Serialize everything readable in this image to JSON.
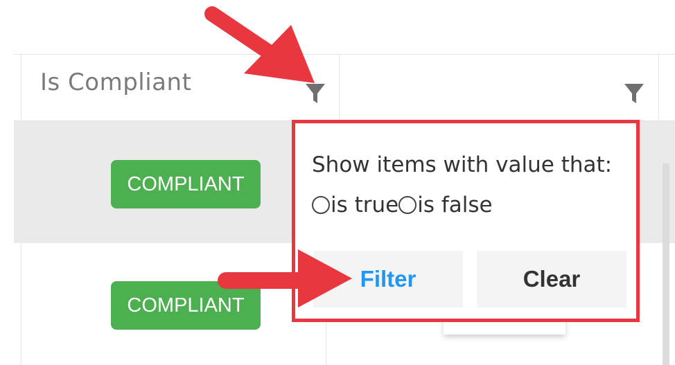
{
  "grid": {
    "columns": [
      {
        "title": "Is Compliant",
        "filter_icon": "filter-icon"
      },
      {
        "title": "",
        "filter_icon": "filter-icon"
      }
    ],
    "rows": [
      {
        "status": "COMPLIANT",
        "status_color": "#4caf50"
      },
      {
        "status": "COMPLIANT",
        "status_color": "#4caf50"
      }
    ]
  },
  "filter_popup": {
    "title": "Show items with value that:",
    "options": [
      {
        "label": "is true",
        "selected": false
      },
      {
        "label": "is false",
        "selected": false
      }
    ],
    "filter_label": "Filter",
    "clear_label": "Clear",
    "highlight_color": "#e8373f",
    "filter_color": "#2196f3"
  },
  "annotations": {
    "arrow_color": "#e8373f",
    "arrows": [
      "arrow-to-filter-icon",
      "arrow-to-filter-button"
    ]
  }
}
